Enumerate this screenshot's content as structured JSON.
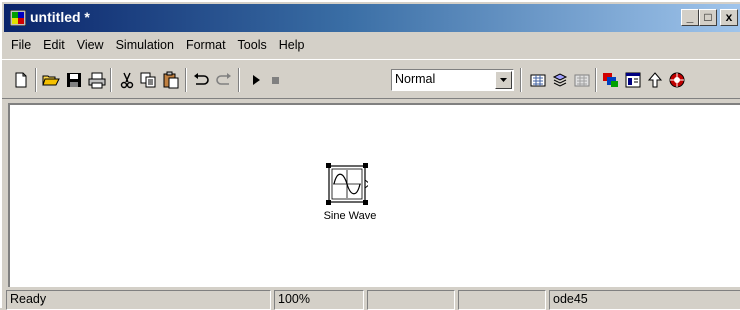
{
  "window": {
    "title": "untitled *",
    "minimize_label": "_",
    "maximize_label": "□",
    "close_label": "x"
  },
  "menu": [
    "File",
    "Edit",
    "View",
    "Simulation",
    "Format",
    "Tools",
    "Help"
  ],
  "toolbar": {
    "simulation_mode": "Normal",
    "buttons": [
      "new-model",
      "open",
      "save",
      "print",
      "cut",
      "copy",
      "paste",
      "undo",
      "redo",
      "start-simulation",
      "stop-simulation",
      "build",
      "update-diagram",
      "build-subsystem",
      "library-browser",
      "model-explorer",
      "go-to-parent",
      "debug"
    ]
  },
  "canvas": {
    "blocks": [
      {
        "name": "Sine Wave",
        "icon": "sine-wave-icon",
        "selected": true
      }
    ]
  },
  "statusbar": {
    "status": "Ready",
    "zoom": "100%",
    "panel3": "",
    "panel4": "",
    "solver": "ode45"
  },
  "colors": {
    "titlebar_start": "#0a246a",
    "titlebar_end": "#a6caf0",
    "chrome": "#d4d0c8",
    "canvas": "#ffffff"
  }
}
